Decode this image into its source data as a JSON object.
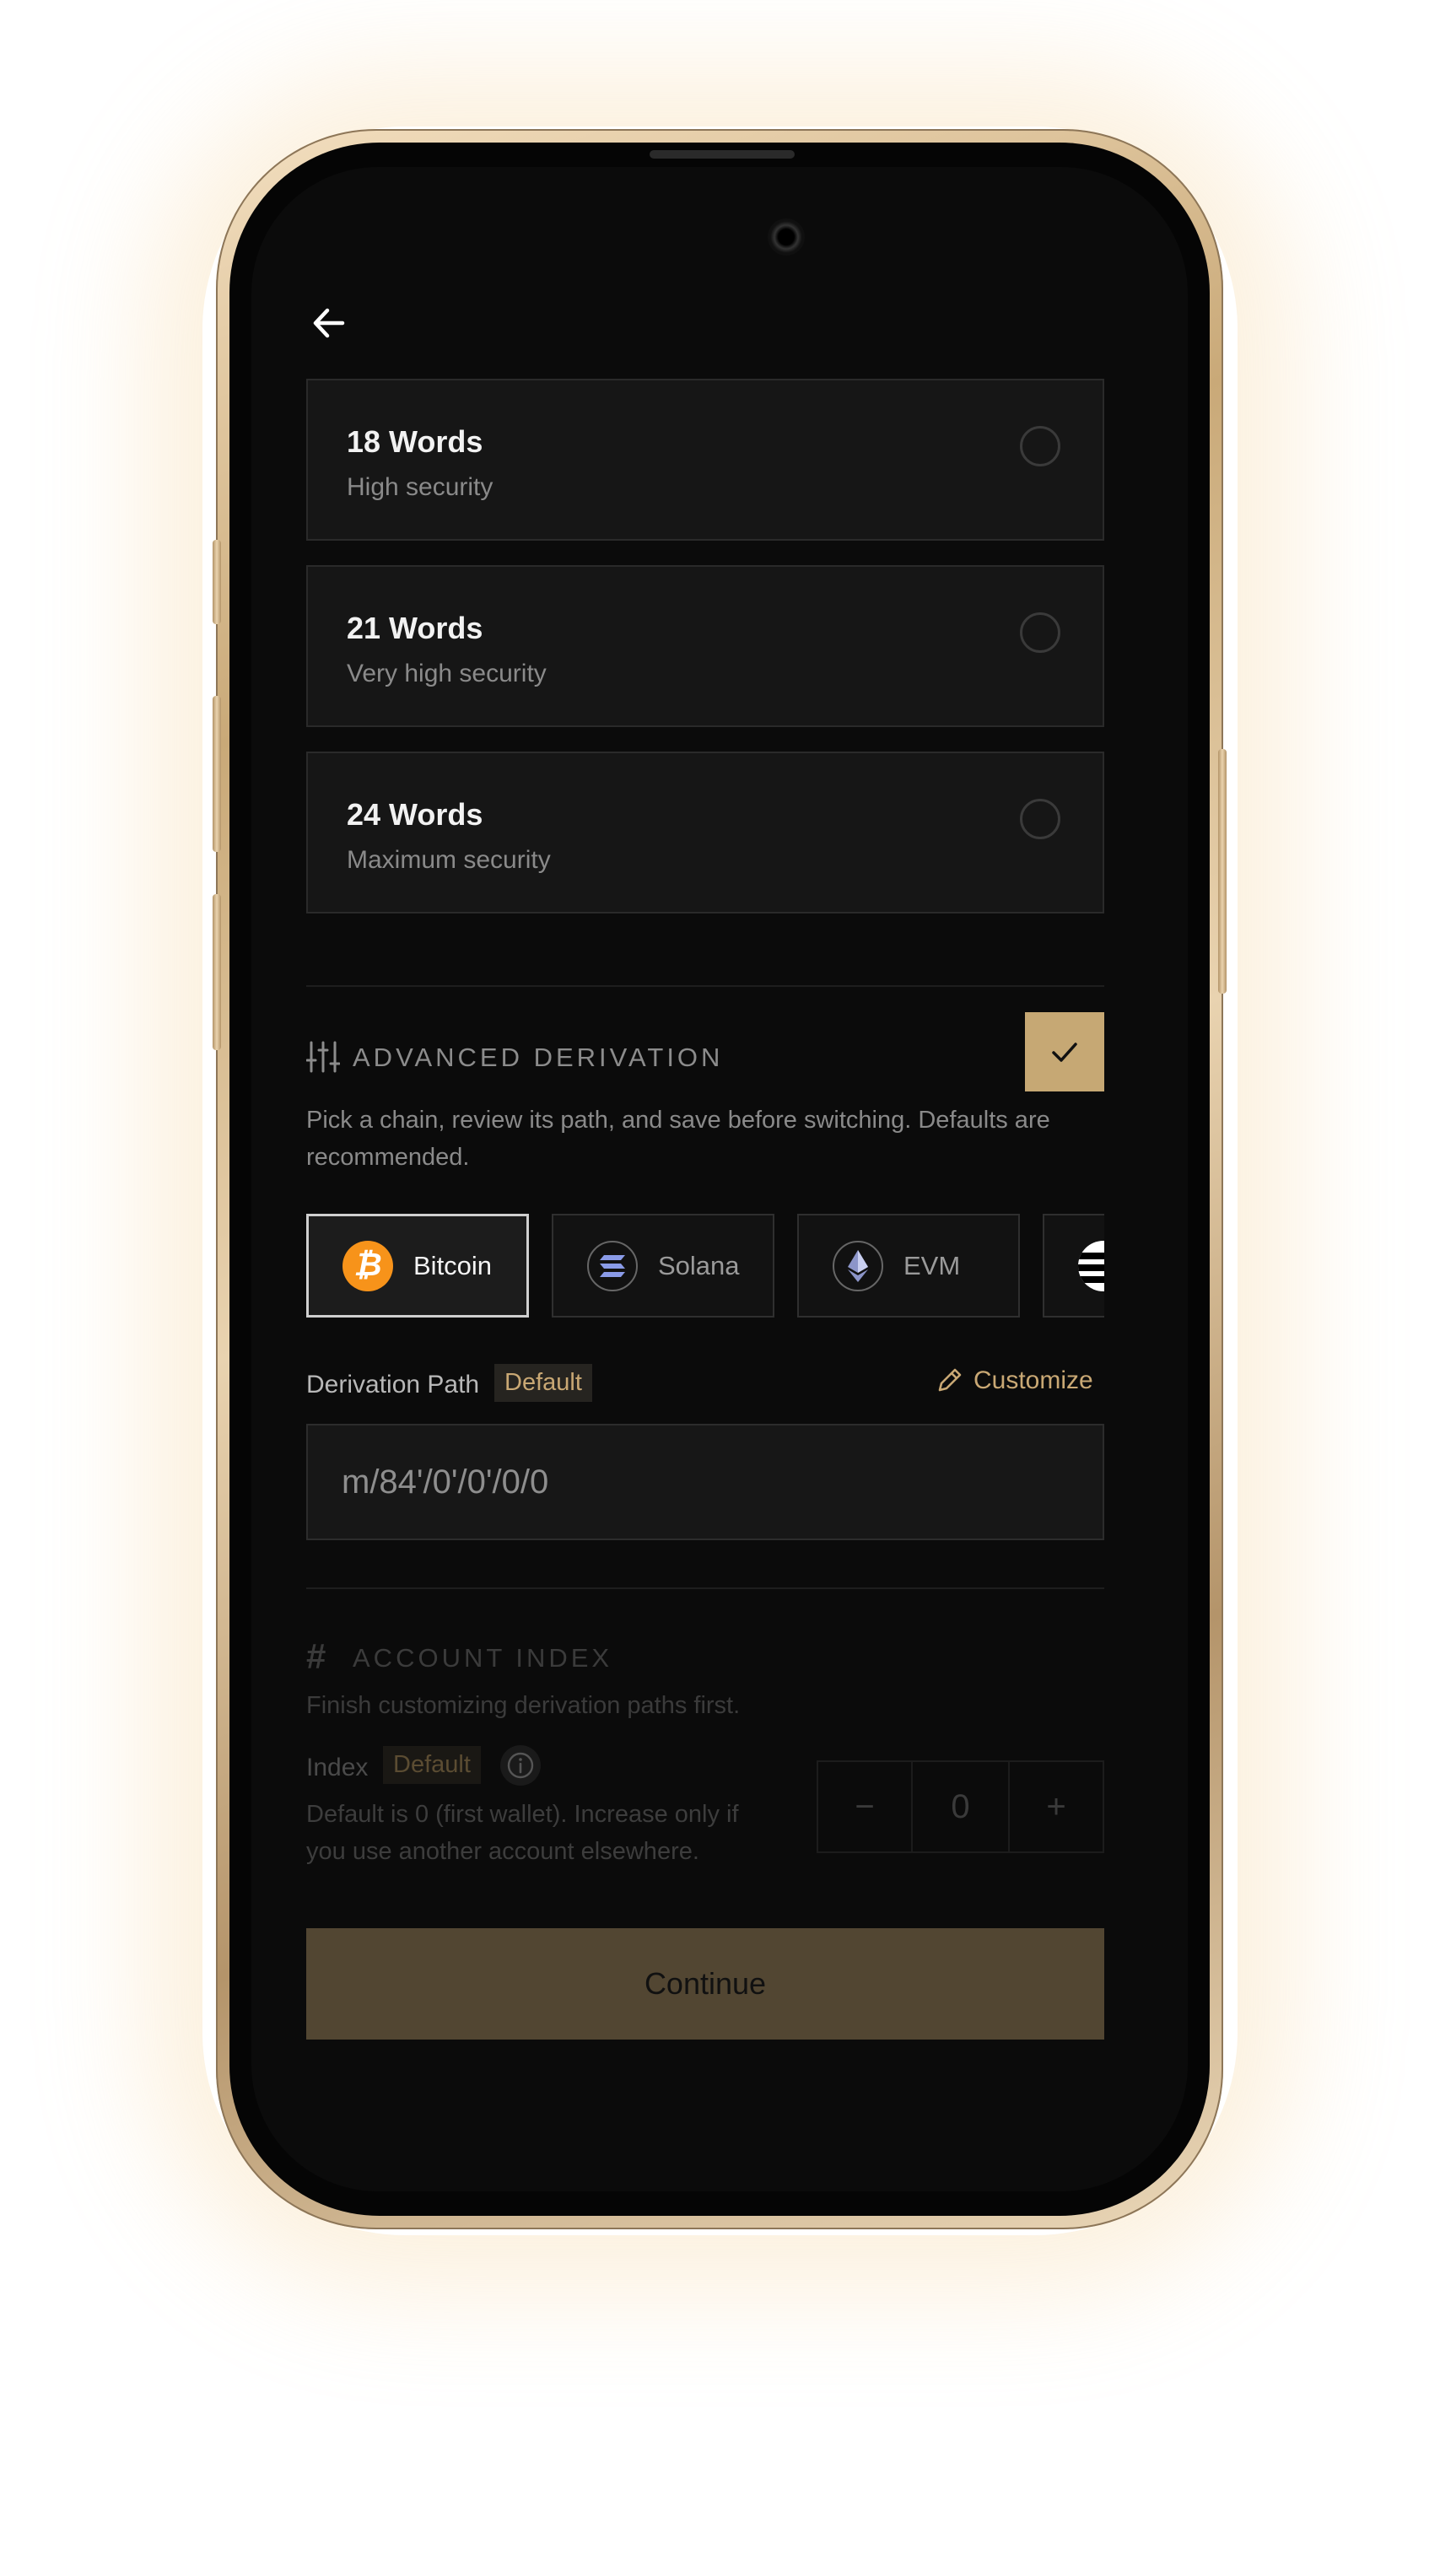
{
  "options": [
    {
      "title": "18 Words",
      "subtitle": "High security"
    },
    {
      "title": "21 Words",
      "subtitle": "Very high security"
    },
    {
      "title": "24 Words",
      "subtitle": "Maximum security"
    }
  ],
  "advanced": {
    "title": "ADVANCED DERIVATION",
    "description": "Pick a chain, review its path, and save before switching. Defaults are recommended.",
    "enabled": true
  },
  "chains": [
    {
      "label": "Bitcoin",
      "icon": "bitcoin-icon",
      "color": "#F7931A",
      "selected": true
    },
    {
      "label": "Solana",
      "icon": "solana-icon",
      "color": "#8A9BE8",
      "selected": false
    },
    {
      "label": "EVM",
      "icon": "ethereum-icon",
      "color": "#6A7BB8",
      "selected": false
    },
    {
      "label": "",
      "icon": "striped-chain-icon",
      "color": "#ffffff",
      "selected": false
    }
  ],
  "derivation": {
    "label": "Derivation Path",
    "badge": "Default",
    "customize": "Customize",
    "path": "m/84'/0'/0'/0/0"
  },
  "account": {
    "title": "ACCOUNT INDEX",
    "note": "Finish customizing derivation paths first.",
    "index_label": "Index",
    "index_badge": "Default",
    "description": "Default is 0 (first wallet). Increase only if you use another account elsewhere.",
    "value": "0",
    "minus": "−",
    "plus": "+"
  },
  "continue_label": "Continue",
  "colors": {
    "accent": "#C6A874",
    "background": "#0B0B0B"
  }
}
